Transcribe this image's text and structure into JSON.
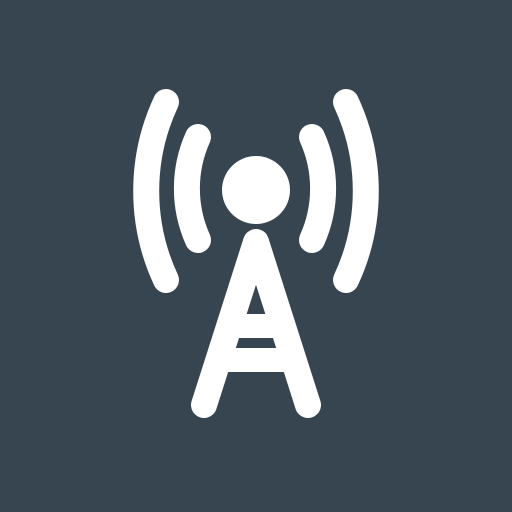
{
  "icon": {
    "name": "radio-tower-icon",
    "background_color": "#36454f",
    "foreground_color": "#ffffff"
  }
}
